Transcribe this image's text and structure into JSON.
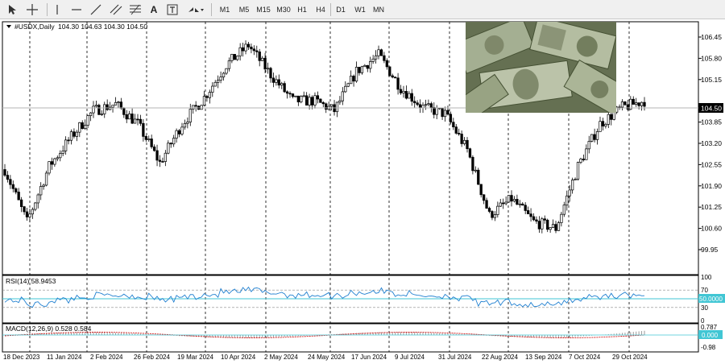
{
  "toolbar": {
    "timeframes": [
      "M1",
      "M5",
      "M15",
      "M30",
      "H1",
      "H4",
      "D1",
      "W1",
      "MN"
    ]
  },
  "chart": {
    "symbol_title": "#USDX,Daily",
    "ohlc_text": "104.30 104.63 104.30 104.50",
    "current_price": "104.50",
    "price_levels": [
      "106.45",
      "105.80",
      "105.15",
      "104.50",
      "103.85",
      "103.20",
      "102.55",
      "101.90",
      "101.25",
      "100.60",
      "99.95"
    ],
    "date_labels": [
      "18 Dec 2023",
      "11 Jan 2024",
      "2 Feb 2024",
      "26 Feb 2024",
      "19 Mar 2024",
      "10 Apr 2024",
      "2 May 2024",
      "24 May 2024",
      "17 Jun 2024",
      "9 Jul 2024",
      "31 Jul 2024",
      "22 Aug 2024",
      "13 Sep 2024",
      "7 Oct 2024",
      "29 Oct 2024"
    ]
  },
  "rsi": {
    "title": "RSI(14) 58.9453",
    "levels": [
      "100",
      "70",
      "50.0000",
      "30",
      "0"
    ]
  },
  "macd": {
    "title": "MACD(12,26,9) 0.528 0.584",
    "levels": [
      "0.787",
      "0.000",
      "-0.98"
    ]
  },
  "chart_data": {
    "type": "candlestick",
    "title": "#USDX,Daily",
    "ylim": [
      99.95,
      106.45
    ],
    "price_path": [
      {
        "date": "18 Dec 2023",
        "close": 102.4
      },
      {
        "date": "28 Dec 2023",
        "close": 100.8
      },
      {
        "date": "11 Jan 2024",
        "close": 102.5
      },
      {
        "date": "20 Jan 2024",
        "close": 103.4
      },
      {
        "date": "2 Feb 2024",
        "close": 104.2
      },
      {
        "date": "14 Feb 2024",
        "close": 104.4
      },
      {
        "date": "26 Feb 2024",
        "close": 103.8
      },
      {
        "date": "8 Mar 2024",
        "close": 102.6
      },
      {
        "date": "19 Mar 2024",
        "close": 103.8
      },
      {
        "date": "1 Apr 2024",
        "close": 104.6
      },
      {
        "date": "10 Apr 2024",
        "close": 105.6
      },
      {
        "date": "16 Apr 2024",
        "close": 106.2
      },
      {
        "date": "2 May 2024",
        "close": 105.3
      },
      {
        "date": "14 May 2024",
        "close": 104.5
      },
      {
        "date": "24 May 2024",
        "close": 104.5
      },
      {
        "date": "5 Jun 2024",
        "close": 104.2
      },
      {
        "date": "17 Jun 2024",
        "close": 105.4
      },
      {
        "date": "26 Jun 2024",
        "close": 105.9
      },
      {
        "date": "9 Jul 2024",
        "close": 104.9
      },
      {
        "date": "20 Jul 2024",
        "close": 104.3
      },
      {
        "date": "31 Jul 2024",
        "close": 104.1
      },
      {
        "date": "8 Aug 2024",
        "close": 103.0
      },
      {
        "date": "22 Aug 2024",
        "close": 101.0
      },
      {
        "date": "1 Sep 2024",
        "close": 101.5
      },
      {
        "date": "13 Sep 2024",
        "close": 100.8
      },
      {
        "date": "25 Sep 2024",
        "close": 100.6
      },
      {
        "date": "7 Oct 2024",
        "close": 102.5
      },
      {
        "date": "18 Oct 2024",
        "close": 103.8
      },
      {
        "date": "29 Oct 2024",
        "close": 104.3
      },
      {
        "date": "5 Nov 2024",
        "close": 104.5
      }
    ],
    "rsi_levels": [
      70,
      50,
      30
    ]
  }
}
